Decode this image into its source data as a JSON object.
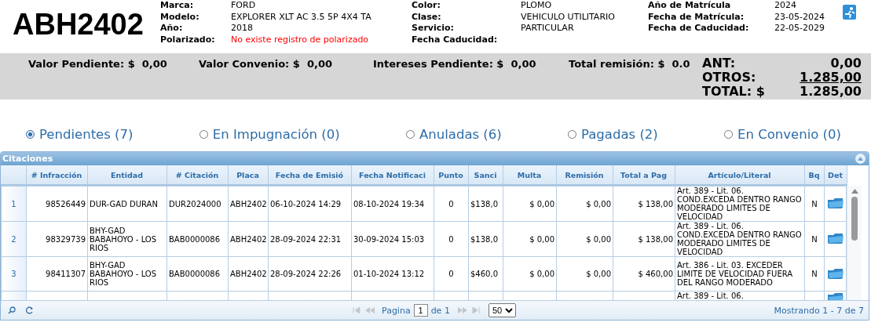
{
  "vehicle": {
    "plate": "ABH2402",
    "field_columns": [
      [
        {
          "label": "Marca:",
          "value": "FORD",
          "alert": false
        },
        {
          "label": "Modelo:",
          "value": "EXPLORER XLT AC 3.5 5P 4X4 TA",
          "alert": false
        },
        {
          "label": "Año:",
          "value": "2018",
          "alert": false
        },
        {
          "label": "Polarizado:",
          "value": "No existe registro de polarizado",
          "alert": true
        }
      ],
      [
        {
          "label": "Color:",
          "value": "PLOMO",
          "alert": false
        },
        {
          "label": "Clase:",
          "value": "VEHICULO UTILITARIO",
          "alert": false
        },
        {
          "label": "Servicio:",
          "value": "PARTICULAR",
          "alert": false
        },
        {
          "label": "Fecha Caducidad:"
        }
      ],
      [
        {
          "label": "Año de Matrícula",
          "value": "2024",
          "alert": false
        },
        {
          "label": "Fecha de Matrícula:",
          "value": "23-05-2024",
          "alert": false
        },
        {
          "label": "Fecha de Caducidad:",
          "value": "22-05-2029",
          "alert": false
        }
      ]
    ]
  },
  "summary": {
    "items": [
      {
        "label": "Valor Pendiente: $",
        "value": "0,00"
      },
      {
        "label": "Valor Convenio: $",
        "value": "0,00"
      },
      {
        "label": "Intereses Pendiente: $",
        "value": "0,00"
      },
      {
        "label": "Total remisión: $",
        "value": "0.0"
      }
    ],
    "totals": [
      {
        "label": "ANT:",
        "value": "0,00",
        "underlined": false
      },
      {
        "label": "OTROS:",
        "value": "1.285,00",
        "underlined": true
      },
      {
        "label": "TOTAL: $",
        "value": "1.285,00",
        "underlined": false
      }
    ]
  },
  "tabs": [
    {
      "label": "Pendientes (7)",
      "selected": true
    },
    {
      "label": "En Impugnación (0)",
      "selected": false
    },
    {
      "label": "Anuladas (6)",
      "selected": false
    },
    {
      "label": "Pagadas (2)",
      "selected": false
    },
    {
      "label": "En Convenio (0)",
      "selected": false
    }
  ],
  "grid": {
    "title": "Citaciones",
    "columns": [
      "# Infracción",
      "Entidad",
      "# Citación",
      "Placa",
      "Fecha de Emisió",
      "Fecha Notificaci",
      "Punto",
      "Sanci",
      "Multa",
      "Remisión",
      "Total a Pag",
      "Artículo/Literal",
      "Bq",
      "Det"
    ],
    "rows": [
      {
        "number": "1",
        "cells": [
          "98526449",
          "DUR-GAD DURAN",
          "DUR2024000",
          "ABH2402",
          "06-10-2024 14:29",
          "08-10-2024 19:34",
          "0",
          "$138,0",
          "$ 0,00",
          "$ 0,00",
          "$ 138,00",
          "Art. 389 - Lit. 06. COND.EXCEDA DENTRO RANGO MODERADO LIMITES DE VELOCIDAD",
          "N"
        ]
      },
      {
        "number": "2",
        "cells": [
          "98329739",
          "BHY-GAD BABAHOYO - LOS RIOS",
          "BAB0000086",
          "ABH2402",
          "28-09-2024 22:31",
          "30-09-2024 15:03",
          "0",
          "$138,0",
          "$ 0,00",
          "$ 0,00",
          "$ 138,00",
          "Art. 389 - Lit. 06. COND.EXCEDA DENTRO RANGO MODERADO LIMITES DE VELOCIDAD",
          "N"
        ]
      },
      {
        "number": "3",
        "cells": [
          "98411307",
          "BHY-GAD BABAHOYO - LOS RIOS",
          "BAB0000086",
          "ABH2402",
          "28-09-2024 22:26",
          "01-10-2024 13:12",
          "0",
          "$460,0",
          "$ 0,00",
          "$ 0,00",
          "$ 460,00",
          "Art. 386 - Lit. 03. EXCEDER LIMITE DE VELOCIDAD FUERA DEL RANGO MODERADO",
          "N"
        ]
      },
      {
        "cells": [
          null,
          null,
          null,
          null,
          null,
          null,
          null,
          null,
          null,
          null,
          null,
          "Art. 389 - Lit. 06.",
          null
        ]
      }
    ]
  },
  "pager": {
    "page_label": "Pagina",
    "page": "1",
    "of_label": "de 1",
    "page_size": "50",
    "status": "Mostrando 1 - 7 de 7"
  }
}
